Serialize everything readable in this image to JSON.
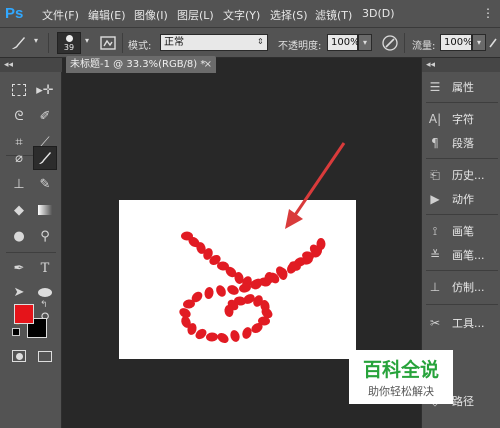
{
  "app": {
    "logo": "Ps"
  },
  "menu": [
    "文件(F)",
    "编辑(E)",
    "图像(I)",
    "图层(L)",
    "文字(Y)",
    "选择(S)",
    "滤镜(T)",
    "3D(D)"
  ],
  "menu_more": "⋮",
  "options_bar": {
    "brush_size": "39",
    "mode_label": "模式:",
    "mode_value": "正常",
    "opacity_label": "不透明度:",
    "opacity_value": "100%",
    "flow_label": "流量:",
    "flow_value": "100%"
  },
  "tools_header": "◂◂",
  "document_tab": {
    "title": "未标题-1 @ 33.3%(RGB/8) *",
    "close": "×"
  },
  "colors": {
    "foreground": "#e5141a",
    "background": "#000000",
    "brush_stroke": "#e11b23",
    "arrow": "#d93b3b",
    "accent_green": "#27a33b"
  },
  "right_dock": {
    "header": "◂◂",
    "items": [
      {
        "label": "属性",
        "icon": "properties-icon"
      },
      {
        "label": "字符",
        "icon": "character-icon"
      },
      {
        "label": "段落",
        "icon": "paragraph-icon"
      },
      {
        "label": "历史...",
        "icon": "history-icon"
      },
      {
        "label": "动作",
        "icon": "actions-icon"
      },
      {
        "label": "画笔",
        "icon": "brush-icon"
      },
      {
        "label": "画笔...",
        "icon": "brush-presets-icon"
      },
      {
        "label": "仿制...",
        "icon": "clone-source-icon"
      },
      {
        "label": "工具...",
        "icon": "tool-presets-icon"
      },
      {
        "label": "路径",
        "icon": "paths-icon"
      }
    ]
  },
  "watermark": {
    "title": "百科全说",
    "subtitle": "助你轻松解决"
  }
}
